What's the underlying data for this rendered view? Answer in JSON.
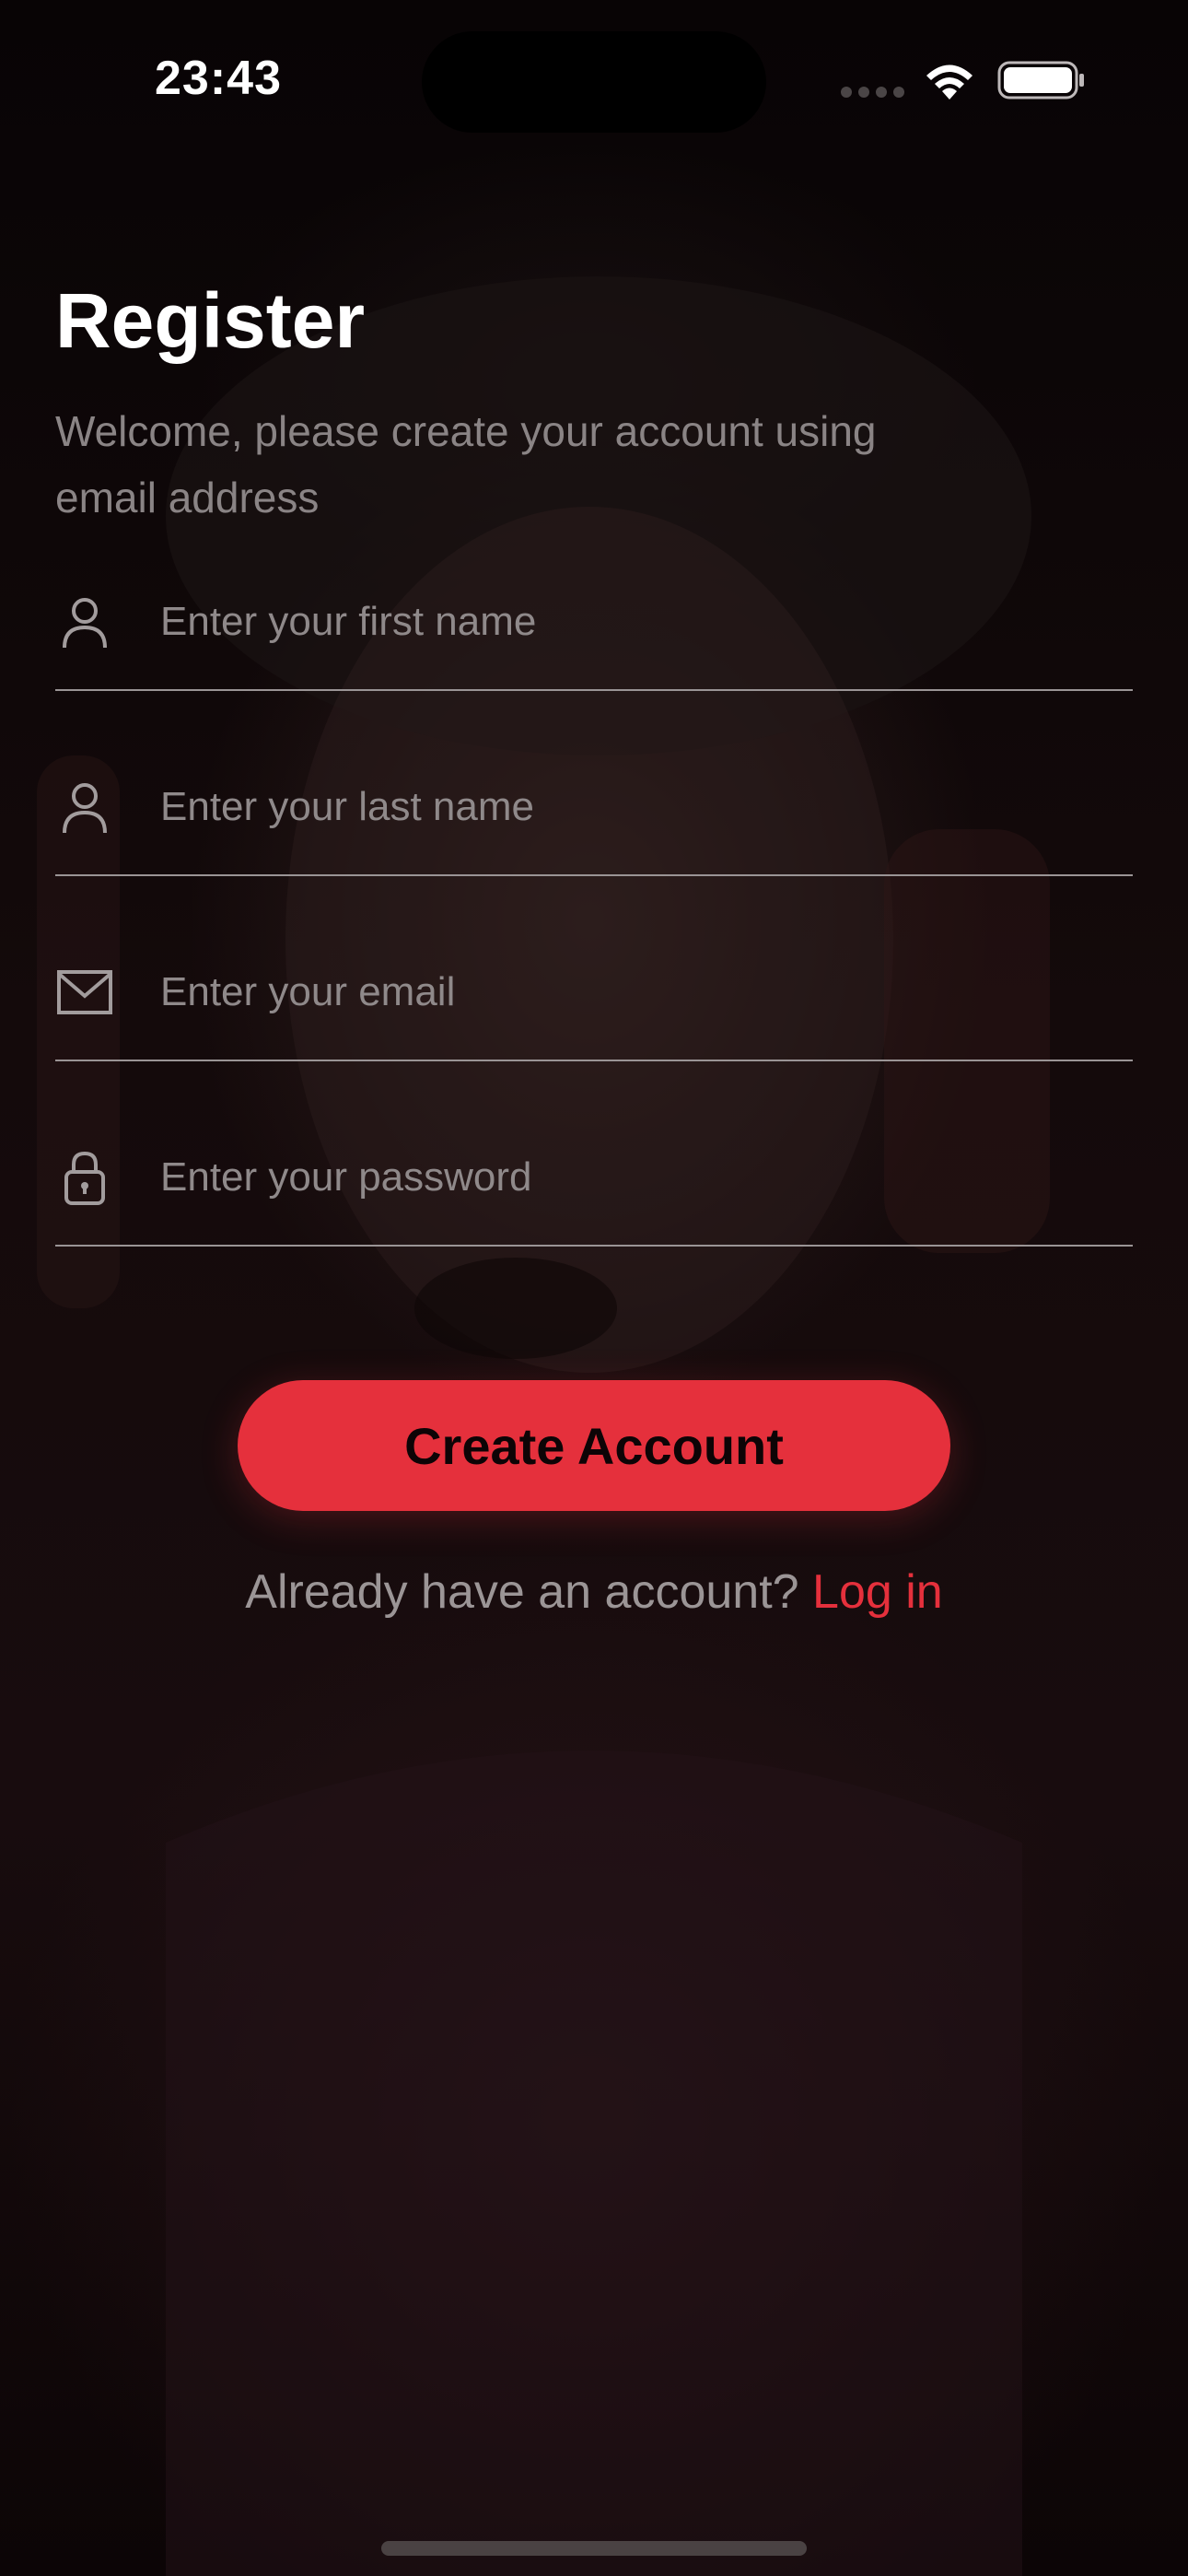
{
  "status_bar": {
    "time": "23:43",
    "icons": [
      "cellular-signal-icon",
      "wifi-icon",
      "battery-icon"
    ]
  },
  "register": {
    "title": "Register",
    "subtitle": "Welcome, please create your account using email address"
  },
  "fields": {
    "first_name": {
      "placeholder": "Enter your first name",
      "value": "",
      "icon": "person-icon"
    },
    "last_name": {
      "placeholder": "Enter your last name",
      "value": "",
      "icon": "person-icon"
    },
    "email": {
      "placeholder": "Enter your email",
      "value": "",
      "icon": "envelope-icon"
    },
    "password": {
      "placeholder": "Enter your password",
      "value": "",
      "icon": "lock-icon"
    }
  },
  "actions": {
    "create_account_label": "Create Account",
    "login_prompt": "Already have an account?",
    "login_link": "Log in"
  },
  "colors": {
    "accent": "#e5303c",
    "background": "#0b0506",
    "placeholder": "#8f898a",
    "divider": "#9a9495"
  }
}
